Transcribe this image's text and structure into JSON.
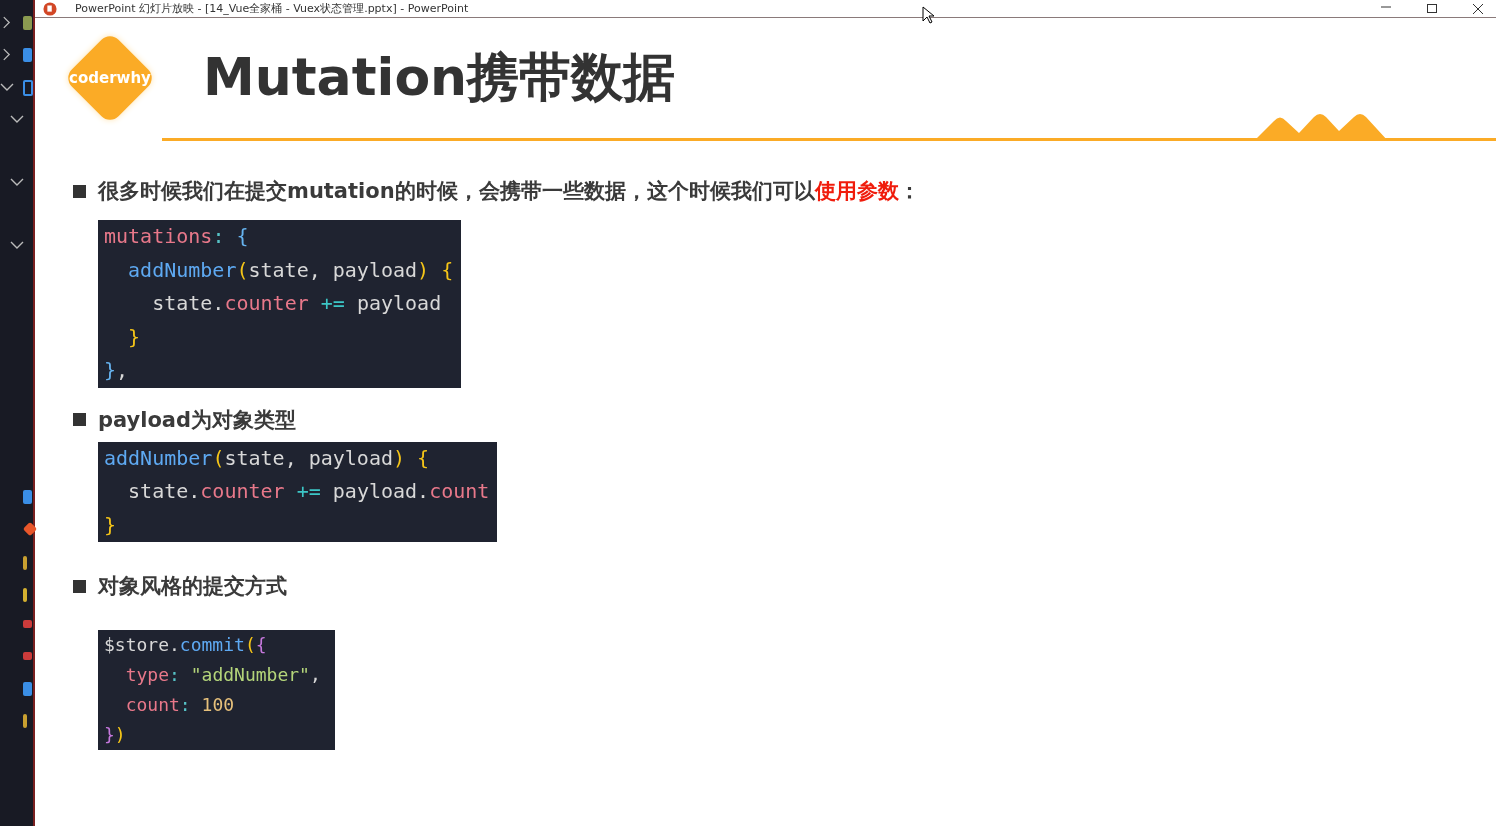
{
  "window": {
    "title": "PowerPoint 幻灯片放映 - [14_Vue全家桶 - Vuex状态管理.pptx] - PowerPoint"
  },
  "slide": {
    "logo": "coderwhy",
    "title": "Mutation携带数据",
    "sections": [
      {
        "heading": [
          {
            "text": "很多时候我们在提交mutation的时候，会携带一些数据，这个时候我们可以",
            "emphasis": false
          },
          {
            "text": "使用参数",
            "emphasis": true
          },
          {
            "text": "：",
            "emphasis": false
          }
        ],
        "code": [
          [
            {
              "text": "mutations",
              "kind": "key"
            },
            {
              "text": ": ",
              "kind": "punct"
            },
            {
              "text": "{",
              "kind": "brace"
            }
          ],
          [
            {
              "text": "  addNumber",
              "kind": "func"
            },
            {
              "text": "(",
              "kind": "paren"
            },
            {
              "text": "state, payload",
              "kind": "plain"
            },
            {
              "text": ")",
              "kind": "paren"
            },
            {
              "text": " {",
              "kind": "paren"
            }
          ],
          [
            {
              "text": "    state.",
              "kind": "plain"
            },
            {
              "text": "counter",
              "kind": "key"
            },
            {
              "text": " += ",
              "kind": "op"
            },
            {
              "text": "payload",
              "kind": "plain"
            }
          ],
          [
            {
              "text": "  }",
              "kind": "paren"
            }
          ],
          [
            {
              "text": "}",
              "kind": "brace"
            },
            {
              "text": ",",
              "kind": "plain"
            }
          ]
        ]
      },
      {
        "heading": [
          {
            "text": "payload为对象类型",
            "emphasis": false
          }
        ],
        "code": [
          [
            {
              "text": "addNumber",
              "kind": "func"
            },
            {
              "text": "(",
              "kind": "paren"
            },
            {
              "text": "state, payload",
              "kind": "plain"
            },
            {
              "text": ")",
              "kind": "paren"
            },
            {
              "text": " {",
              "kind": "paren"
            }
          ],
          [
            {
              "text": "  state.",
              "kind": "plain"
            },
            {
              "text": "counter",
              "kind": "key"
            },
            {
              "text": " += ",
              "kind": "op"
            },
            {
              "text": "payload.",
              "kind": "plain"
            },
            {
              "text": "count",
              "kind": "key"
            }
          ],
          [
            {
              "text": "}",
              "kind": "paren"
            }
          ]
        ]
      },
      {
        "heading": [
          {
            "text": "对象风格的提交方式",
            "emphasis": false
          }
        ],
        "code": [
          [
            {
              "text": "$store.",
              "kind": "plain"
            },
            {
              "text": "commit",
              "kind": "func"
            },
            {
              "text": "(",
              "kind": "paren"
            },
            {
              "text": "{",
              "kind": "purple"
            }
          ],
          [
            {
              "text": "  type",
              "kind": "key"
            },
            {
              "text": ": ",
              "kind": "punct"
            },
            {
              "text": "\"addNumber\"",
              "kind": "string"
            },
            {
              "text": ",",
              "kind": "plain"
            }
          ],
          [
            {
              "text": "  count",
              "kind": "key"
            },
            {
              "text": ": ",
              "kind": "punct"
            },
            {
              "text": "100",
              "kind": "number"
            }
          ],
          [
            {
              "text": "}",
              "kind": "purple"
            },
            {
              "text": ")",
              "kind": "paren"
            }
          ]
        ]
      }
    ]
  }
}
